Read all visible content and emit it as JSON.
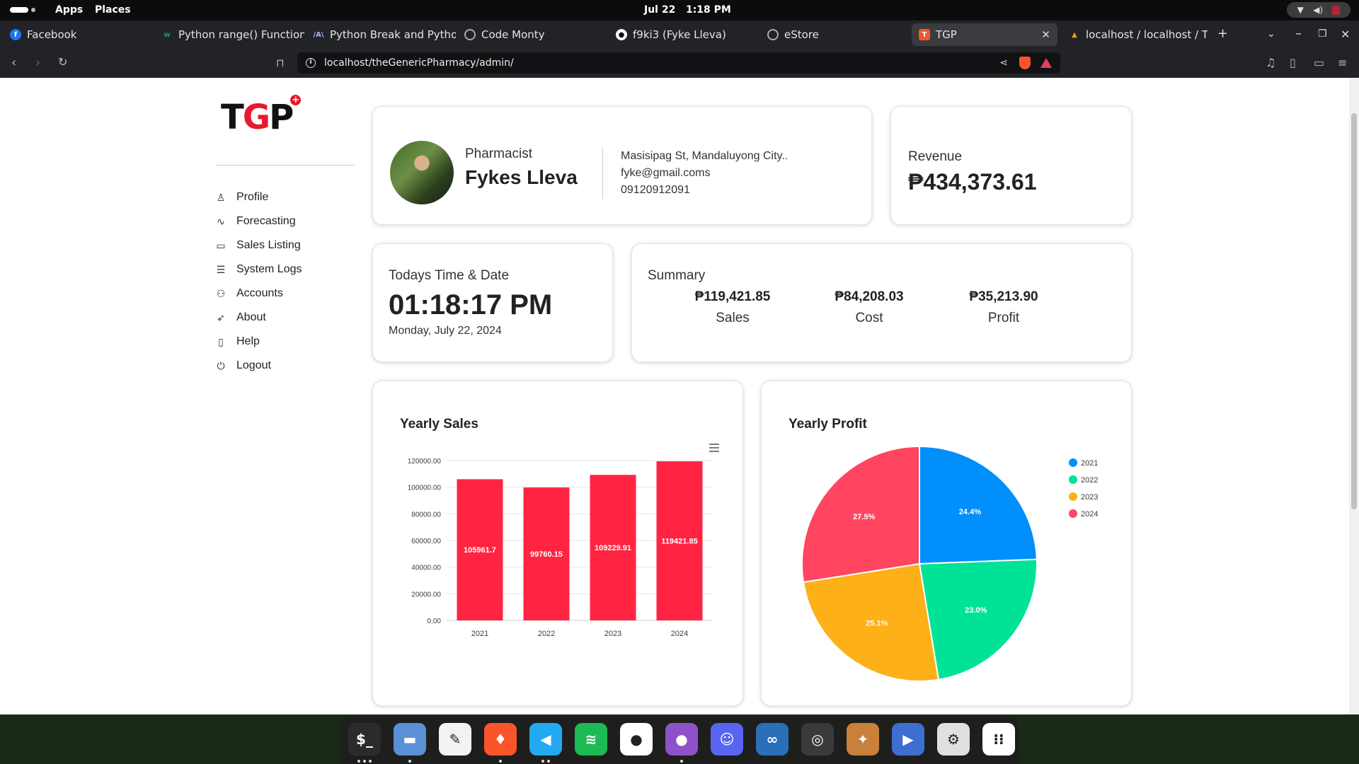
{
  "topbar": {
    "apps_label": "Apps",
    "places_label": "Places",
    "date": "Jul 22",
    "time": "1:18 PM"
  },
  "tabs": [
    {
      "label": "Facebook",
      "favicon": "facebook-icon",
      "color": "#1877f2"
    },
    {
      "label": "Python range() Function",
      "favicon": "w3-icon",
      "color": "#04aa6d"
    },
    {
      "label": "Python Break and Python",
      "favicon": "programiz-icon",
      "color": "#4f46e5"
    },
    {
      "label": "Code Monty",
      "favicon": "globe-icon",
      "color": "#888888"
    },
    {
      "label": "f9ki3 (Fyke Lleva)",
      "favicon": "github-icon",
      "color": "#ffffff"
    },
    {
      "label": "eStore",
      "favicon": "globe-icon",
      "color": "#888888"
    },
    {
      "label": "TGP",
      "favicon": "tgp-icon",
      "color": "#f1592a"
    },
    {
      "label": "localhost / localhost / Ti",
      "favicon": "phpmyadmin-icon",
      "color": "#f89c0e"
    }
  ],
  "address_bar": {
    "url": "localhost/theGenericPharmacy/admin/"
  },
  "sidebar": {
    "logo": {
      "t": "T",
      "g": "G",
      "p": "P",
      "plus": "+"
    },
    "items": [
      {
        "label": "Profile",
        "icon": "user-icon"
      },
      {
        "label": "Forecasting",
        "icon": "activity-icon"
      },
      {
        "label": "Sales Listing",
        "icon": "ticket-icon"
      },
      {
        "label": "System Logs",
        "icon": "list-icon"
      },
      {
        "label": "Accounts",
        "icon": "users-icon"
      },
      {
        "label": "About",
        "icon": "rocket-icon"
      },
      {
        "label": "Help",
        "icon": "book-icon"
      },
      {
        "label": "Logout",
        "icon": "power-icon"
      }
    ]
  },
  "profile": {
    "role": "Pharmacist",
    "name": "Fykes Lleva",
    "address": "Masisipag St, Mandaluyong City..",
    "email": "fyke@gmail.coms",
    "phone": "09120912091"
  },
  "revenue": {
    "label": "Revenue",
    "value": "₱434,373.61"
  },
  "clock": {
    "label": "Todays Time & Date",
    "time": "01:18:17 PM",
    "date": "Monday, July 22, 2024"
  },
  "summary": {
    "label": "Summary",
    "items": [
      {
        "value": "₱119,421.85",
        "caption": "Sales"
      },
      {
        "value": "₱84,208.03",
        "caption": "Cost"
      },
      {
        "value": "₱35,213.90",
        "caption": "Profit"
      }
    ]
  },
  "chart_data": [
    {
      "type": "bar",
      "title": "Yearly Sales",
      "categories": [
        "2021",
        "2022",
        "2023",
        "2024"
      ],
      "values": [
        105961.7,
        99760.15,
        109229.91,
        119421.85
      ],
      "value_labels": [
        "105961.7",
        "99760.15",
        "109229.91",
        "119421.85"
      ],
      "y_ticks": [
        "0.00",
        "20000.00",
        "40000.00",
        "60000.00",
        "80000.00",
        "100000.00",
        "120000.00"
      ],
      "ylim": [
        0,
        120000
      ],
      "color": "#ff2442",
      "grid": true,
      "menu_icon": "hamburger-icon"
    },
    {
      "type": "pie",
      "title": "Yearly Profit",
      "labels": [
        "2021",
        "2022",
        "2023",
        "2024"
      ],
      "values": [
        24.4,
        23.0,
        25.1,
        27.5
      ],
      "value_labels": [
        "24.4%",
        "23.0%",
        "25.1%",
        "27.5%"
      ],
      "colors": [
        "#008ffb",
        "#00e396",
        "#feb019",
        "#ff4560"
      ],
      "legend_position": "right"
    }
  ],
  "dock": [
    {
      "name": "terminal-icon",
      "color": "#2b2b2b"
    },
    {
      "name": "files-icon",
      "color": "#5b8fd6"
    },
    {
      "name": "text-editor-icon",
      "color": "#f2f2f2"
    },
    {
      "name": "brave-icon",
      "color": "#fb542b"
    },
    {
      "name": "vscode-icon",
      "color": "#23a9f2"
    },
    {
      "name": "spotify-icon",
      "color": "#1db954"
    },
    {
      "name": "github-icon",
      "color": "#ffffff"
    },
    {
      "name": "github-desktop-icon",
      "color": "#8e52c8"
    },
    {
      "name": "discord-icon",
      "color": "#5865f2"
    },
    {
      "name": "steam-icon",
      "color": "#2a6fb8"
    },
    {
      "name": "obs-icon",
      "color": "#3a3a3a"
    },
    {
      "name": "chicken-game-icon",
      "color": "#c8803a"
    },
    {
      "name": "sublime-merge-icon",
      "color": "#3d6fd1"
    },
    {
      "name": "settings-icon",
      "color": "#e0e0e0"
    },
    {
      "name": "app-grid-icon",
      "color": "#ffffff"
    }
  ]
}
